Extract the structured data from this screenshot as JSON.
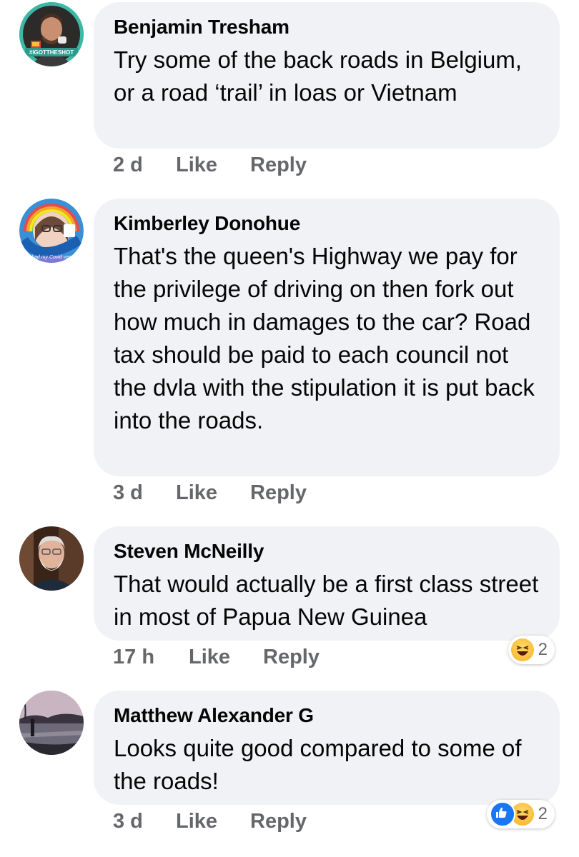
{
  "comments": [
    {
      "author": "Benjamin Tresham",
      "text": "Try some of the back roads in Belgium, or a road ‘trail’ in loas or Vietnam",
      "time": "2 d",
      "like_label": "Like",
      "reply_label": "Reply",
      "avatar_badge": "#IGOTTHESHOT"
    },
    {
      "author": "Kimberley Donohue",
      "text": "That's the queen's Highway we pay for the privilege of driving on then fork out how much in damages to the car? Road tax should be paid to each council not the dvla with the stipulation it is put back into the roads.",
      "time": "3 d",
      "like_label": "Like",
      "reply_label": "Reply",
      "avatar_badge": "I've had my Covid vaccine"
    },
    {
      "author": "Steven McNeilly",
      "text": "That would actually be a first class street in most of Papua New Guinea",
      "time": "17 h",
      "like_label": "Like",
      "reply_label": "Reply",
      "reaction_count": "2",
      "reactions": [
        "haha-icon"
      ]
    },
    {
      "author": "Matthew Alexander G",
      "text": "Looks quite good compared to some of the roads!",
      "time": "3 d",
      "like_label": "Like",
      "reply_label": "Reply",
      "reaction_count": "2",
      "reactions": [
        "like-icon",
        "haha-icon"
      ]
    }
  ],
  "colors": {
    "bubble": "#f0f2f5",
    "meta": "#65676b",
    "like_blue": "#1877f2",
    "haha_yellow": "#f7b125"
  }
}
